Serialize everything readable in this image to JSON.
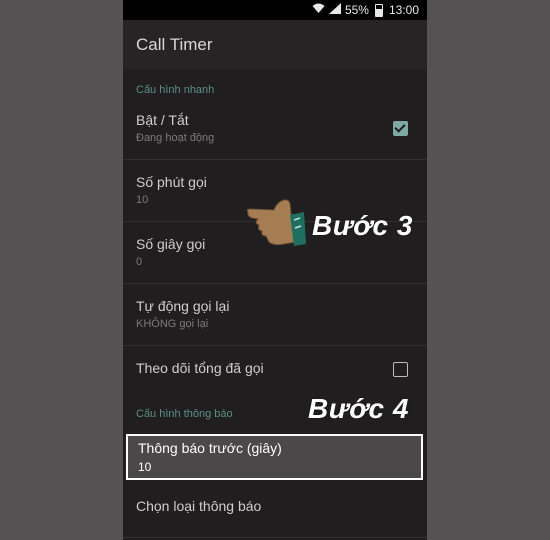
{
  "status_bar": {
    "battery_percent": "55%",
    "time": "13:00"
  },
  "app_bar": {
    "title": "Call Timer"
  },
  "sections": {
    "quick": "Cấu hình nhanh",
    "notify": "Cấu hình thông báo"
  },
  "prefs": {
    "toggle": {
      "title": "Bật / Tắt",
      "summary": "Đang hoạt động",
      "checked": true
    },
    "minutes": {
      "title": "Số phút gọi",
      "summary": "10"
    },
    "seconds": {
      "title": "Số giây gọi",
      "summary": "0"
    },
    "redial": {
      "title": "Tự động gọi lại",
      "summary": "KHÔNG gọi lại"
    },
    "track_total": {
      "title": "Theo dõi tổng đã gọi",
      "checked": false
    },
    "advance_notice": {
      "title": "Thông báo trước (giây)",
      "summary": "10"
    },
    "notify_type": {
      "title": "Chọn loại thông báo"
    }
  },
  "annotations": {
    "step3": "Bước 3",
    "step4": "Bước 4"
  },
  "icons": {
    "pointer": "pointing-hand-icon",
    "wifi": "wifi-icon",
    "signal": "signal-icon",
    "battery": "battery-icon"
  },
  "colors": {
    "accent": "#5c8f86",
    "background": "#201e1f",
    "highlight_border": "#ffffff"
  }
}
